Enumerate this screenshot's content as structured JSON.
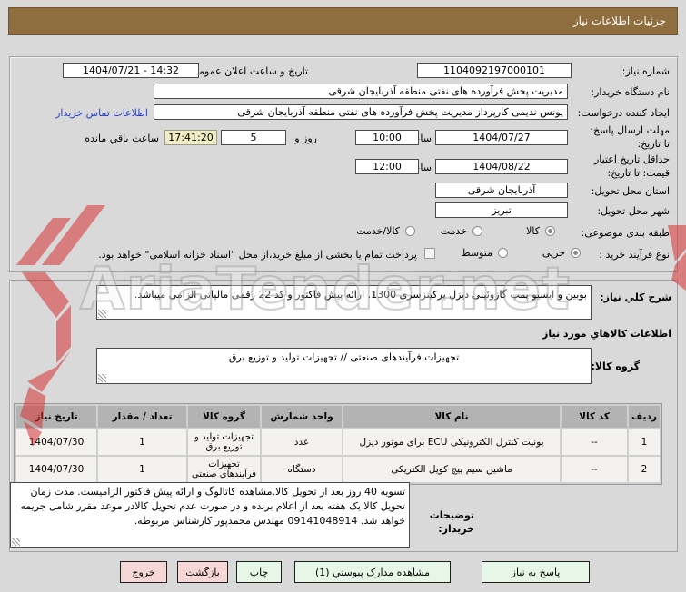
{
  "title_bar": {
    "text": "جزئیات اطلاعات نیاز"
  },
  "form": {
    "need_number": {
      "label": "شماره نیاز:",
      "value": "1104092197000101"
    },
    "announce_datetime": {
      "label": "تاریخ و ساعت اعلان عمومی:",
      "value": "1404/07/21 - 14:32"
    },
    "buyer_org": {
      "label": "نام دستگاه خریدار:",
      "value": "مدیریت پخش فرآورده های نفتی منطقه آذربایجان شرقی"
    },
    "request_creator": {
      "label": "ایجاد کننده درخواست:",
      "value": "یونس ندیمی کارپرداز مدیریت پخش فرآورده های نفتی منطقه آذربایجان شرقی",
      "contact_link": "اطلاعات تماس خریدار"
    },
    "reply_deadline": {
      "label": "مهلت ارسال پاسخ: تا تاریخ:",
      "date": "1404/07/27",
      "hour_label": "ساعت",
      "time": "10:00",
      "days": "5",
      "days_label": "روز و",
      "countdown": "17:41:20",
      "countdown_label": "ساعت باقي مانده"
    },
    "price_validity": {
      "label": "حداقل تاریخ اعتبار قیمت: تا تاریخ:",
      "date": "1404/08/22",
      "hour_label": "ساعت",
      "time": "12:00"
    },
    "province": {
      "label": "استان محل تحویل:",
      "value": "آذربایجان شرقی"
    },
    "city": {
      "label": "شهر محل تحویل:",
      "value": "تبریز"
    },
    "subject_class": {
      "label": "طبقه بندی موضوعی:",
      "options": [
        "کالا",
        "خدمت",
        "کالا/خدمت"
      ],
      "selected": "کالا"
    },
    "process_type": {
      "label": "نوع فرآیند خرید :",
      "options": [
        "جزیی",
        "متوسط"
      ],
      "selected": "جزیی",
      "checkbox_label": "پرداخت تمام یا بخشی از مبلغ خرید،از محل \"اسناد خزانه اسلامی\" خواهد بود.",
      "checkbox_checked": false
    }
  },
  "need_desc": {
    "label": "شرح کلي نیاز:",
    "value": "بوبین و ایسیو پمپ گازوئیلی دیزل پرکینزسری 1300. ارائه پیش فاکتور و کد 22 رقمی مالیاتی الزامی میباشد."
  },
  "goods_section": {
    "header": "اطلاعات کالاهاي مورد نیاز",
    "group_label": "گروه کالا:",
    "group_value": "تجهیزات فرآیندهای صنعتی // تجهیزات تولید و توزیع برق"
  },
  "goods_table": {
    "headers": {
      "row_no": "ردیف",
      "code": "کد کالا",
      "name": "نام کالا",
      "unit": "واحد شمارش",
      "group": "گروه کالا",
      "qty": "تعداد / مقدار",
      "date": "تاریخ نیاز"
    },
    "rows": [
      {
        "row_no": "1",
        "code": "--",
        "name": "یونیت کنترل الکترونیکی ECU برای موتور دیزل",
        "unit": "عدد",
        "group": "تجهیزات تولید و توزیع برق",
        "qty": "1",
        "date": "1404/07/30"
      },
      {
        "row_no": "2",
        "code": "--",
        "name": "ماشین سیم پیچ کویل الکتریکی",
        "unit": "دستگاه",
        "group": "تجهیزات فرآیندهای صنعتی",
        "qty": "1",
        "date": "1404/07/30"
      }
    ]
  },
  "buyer_notes": {
    "label": "توضیحات خریدار:",
    "label_line1": "توضیحات",
    "label_line2": "خریدار:",
    "value": "تسویه 40 روز بعد از تحویل کالا.مشاهده کاتالوگ و ارائه پیش فاکتور الزامیست. مدت زمان تحویل کالا یک هفته بعد از اعلام برنده و در صورت عدم تحویل کالادر موعد مقرر شامل جریمه خواهد شد. 09141048914 مهندس محمدپور  کارشناس مربوطه."
  },
  "buttons": {
    "reply": "پاسخ به نیاز",
    "attachments": "مشاهده مدارک پیوستي (1)",
    "print": "چاپ",
    "back": "بازگشت",
    "exit": "خروج"
  },
  "watermark": {
    "text": "AriaTender.net"
  },
  "colors": {
    "titlebar": "#8e6d3e",
    "countdown_bg": "#f0ecc4",
    "link_blue": "#2a41c8",
    "button_green": "#e7f7e7",
    "button_pink": "#f7d6d6",
    "table_header": "#b3b3b3",
    "watermark_red": "#d63333"
  }
}
